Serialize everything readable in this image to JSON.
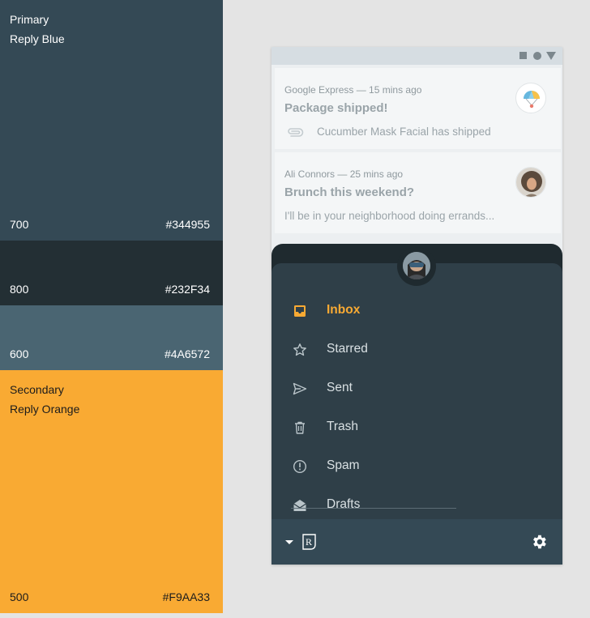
{
  "palette": {
    "primary": {
      "role": "Primary",
      "name": "Reply Blue",
      "swatches": [
        {
          "shade": "700",
          "hex": "#344955"
        },
        {
          "shade": "800",
          "hex": "#232F34"
        },
        {
          "shade": "600",
          "hex": "#4A6572"
        }
      ]
    },
    "secondary": {
      "role": "Secondary",
      "name": "Reply Orange",
      "swatches": [
        {
          "shade": "500",
          "hex": "#F9AA33"
        }
      ]
    }
  },
  "colors": {
    "accent": "#F9AA33",
    "sheet": "#2f3f48",
    "footer": "#344955"
  },
  "emails": [
    {
      "sender": "Google Express",
      "time": "15 mins ago",
      "meta": "Google Express — 15 mins ago",
      "subject": "Package shipped!",
      "preview": "Cucumber Mask Facial has shipped",
      "icon": "attachment-icon",
      "avatar": "parachute-avatar"
    },
    {
      "sender": "Ali Connors",
      "time": "25 mins ago",
      "meta": "Ali Connors — 25 mins ago",
      "subject": "Brunch this weekend?",
      "preview": "I'll be in your neighborhood doing errands...",
      "avatar": "person-avatar"
    }
  ],
  "nav": {
    "items": [
      {
        "label": "Inbox",
        "icon": "inbox-icon",
        "active": true
      },
      {
        "label": "Starred",
        "icon": "star-icon"
      },
      {
        "label": "Sent",
        "icon": "send-icon"
      },
      {
        "label": "Trash",
        "icon": "trash-icon"
      },
      {
        "label": "Spam",
        "icon": "spam-icon"
      },
      {
        "label": "Drafts",
        "icon": "drafts-icon"
      }
    ]
  },
  "footer": {
    "logo": "R",
    "icons": [
      "dropdown-caret-icon",
      "reply-logo-icon",
      "settings-icon"
    ]
  }
}
